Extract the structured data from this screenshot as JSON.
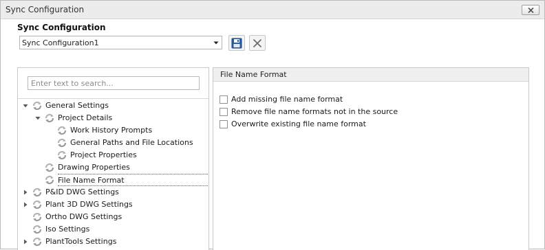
{
  "window": {
    "title": "Sync Configuration"
  },
  "config": {
    "label": "Sync Configuration",
    "selected": "Sync Configuration1"
  },
  "toolbar": {
    "save_icon": "floppy-disk-icon",
    "delete_icon": "x-delete-icon"
  },
  "tree": {
    "search_placeholder": "Enter text to search...",
    "items": [
      {
        "label": "General Settings",
        "level": 0,
        "expander": "open"
      },
      {
        "label": "Project Details",
        "level": 1,
        "expander": "open"
      },
      {
        "label": "Work History Prompts",
        "level": 2,
        "expander": "none"
      },
      {
        "label": "General Paths and File Locations",
        "level": 2,
        "expander": "none"
      },
      {
        "label": "Project Properties",
        "level": 2,
        "expander": "none"
      },
      {
        "label": "Drawing Properties",
        "level": 1,
        "expander": "none"
      },
      {
        "label": "File Name Format",
        "level": 1,
        "expander": "none",
        "selected": true
      },
      {
        "label": "P&ID DWG Settings",
        "level": 0,
        "expander": "closed"
      },
      {
        "label": "Plant 3D DWG Settings",
        "level": 0,
        "expander": "closed"
      },
      {
        "label": "Ortho DWG Settings",
        "level": 0,
        "expander": "none"
      },
      {
        "label": "Iso Settings",
        "level": 0,
        "expander": "none"
      },
      {
        "label": "PlantTools Settings",
        "level": 0,
        "expander": "closed"
      }
    ]
  },
  "panel": {
    "title": "File Name Format",
    "options": [
      {
        "label": "Add missing file name format",
        "checked": false
      },
      {
        "label": "Remove file name formats not in the source",
        "checked": false
      },
      {
        "label": "Overwrite existing file name format",
        "checked": false
      }
    ]
  }
}
